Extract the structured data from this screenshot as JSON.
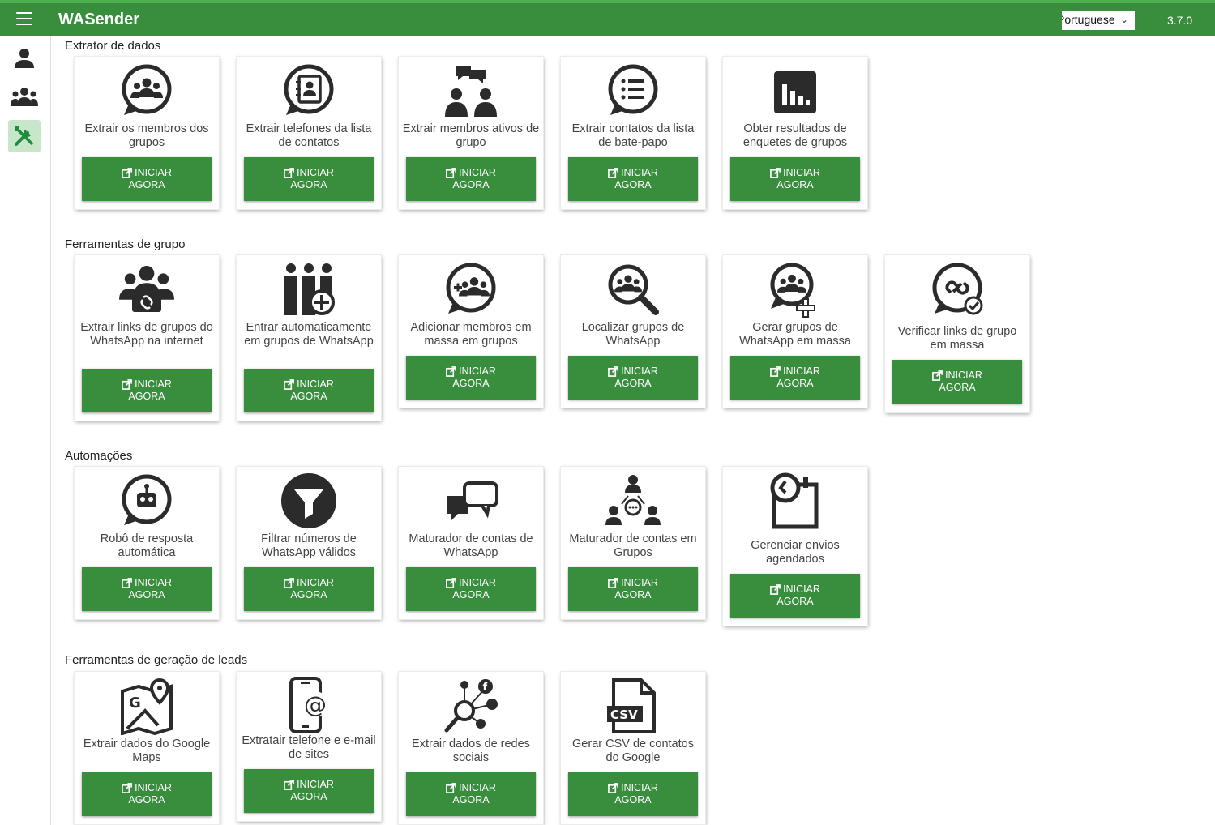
{
  "app": {
    "title": "WASender",
    "version": "3.7.0",
    "language": "Portuguese"
  },
  "sections": [
    {
      "title": "Extrator de dados",
      "cards": [
        {
          "label": "Extrair os membros dos grupos",
          "icon": "chat-group-members-icon"
        },
        {
          "label": "Extrair telefones da lista de contatos",
          "icon": "chat-contact-book-icon"
        },
        {
          "label": "Extrair membros ativos de grupo",
          "icon": "active-members-chat-icon"
        },
        {
          "label": "Extrair contatos da lista de bate-papo",
          "icon": "chat-list-icon"
        },
        {
          "label": "Obter resultados de enquetes de grupos",
          "icon": "poll-chart-icon"
        }
      ]
    },
    {
      "title": "Ferramentas de grupo",
      "cards": [
        {
          "label": "Extrair links de grupos do WhatsApp na internet",
          "icon": "group-link-people-icon"
        },
        {
          "label": "Entrar automaticamente em grupos de WhatsApp",
          "icon": "join-group-plus-icon"
        },
        {
          "label": "Adicionar membros em massa em grupos",
          "icon": "chat-add-members-icon"
        },
        {
          "label": "Localizar grupos de WhatsApp",
          "icon": "search-group-icon"
        },
        {
          "label": "Gerar grupos de WhatsApp em massa",
          "icon": "create-group-plus-icon"
        },
        {
          "label": "Verificar links de grupo em massa",
          "icon": "verify-link-chat-icon"
        }
      ]
    },
    {
      "title": "Automações",
      "cards": [
        {
          "label": "Robô de resposta automática",
          "icon": "chat-robot-icon"
        },
        {
          "label": "Filtrar números de WhatsApp válidos",
          "icon": "filter-funnel-icon"
        },
        {
          "label": "Maturador de contas de WhatsApp",
          "icon": "chat-bubbles-icon"
        },
        {
          "label": "Maturador de contas em Grupos",
          "icon": "group-network-chat-icon"
        },
        {
          "label": "Gerenciar envios agendados",
          "icon": "scheduled-calendar-icon"
        }
      ]
    },
    {
      "title": "Ferramentas de geração de leads",
      "cards": [
        {
          "label": "Extrair dados do Google Maps",
          "icon": "google-maps-icon"
        },
        {
          "label": "Extratair telefone e e-mail de sites",
          "icon": "phone-email-icon"
        },
        {
          "label": "Extrair dados de redes sociais",
          "icon": "social-search-icon"
        },
        {
          "label": "Gerar CSV de contatos do Google",
          "icon": "csv-file-icon"
        }
      ]
    }
  ],
  "button": {
    "line1": "INICIAR",
    "line2": "AGORA"
  },
  "colors": {
    "primary": "#388e3c",
    "topline": "#4caf50",
    "active_nav": "#c8e6c9",
    "icon_dark": "#2b2b2b"
  }
}
